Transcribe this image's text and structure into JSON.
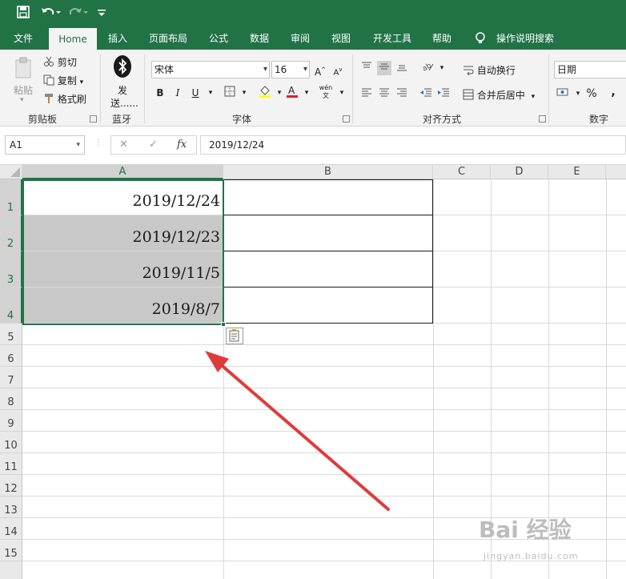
{
  "quick_access": {
    "save_icon": "save-icon",
    "undo_icon": "undo-icon",
    "redo_icon": "redo-icon",
    "customize_icon": "customize-icon"
  },
  "tabs": [
    {
      "label": "文件",
      "active": false
    },
    {
      "label": "Home",
      "active": true
    },
    {
      "label": "插入",
      "active": false
    },
    {
      "label": "页面布局",
      "active": false
    },
    {
      "label": "公式",
      "active": false
    },
    {
      "label": "数据",
      "active": false
    },
    {
      "label": "审阅",
      "active": false
    },
    {
      "label": "视图",
      "active": false
    },
    {
      "label": "开发工具",
      "active": false
    },
    {
      "label": "帮助",
      "active": false
    }
  ],
  "tell_me": "操作说明搜索",
  "ribbon": {
    "clipboard": {
      "paste": "粘贴",
      "cut": "剪切",
      "copy": "复制",
      "format_painter": "格式刷",
      "group": "剪贴板"
    },
    "bluetooth": {
      "send": "发",
      "send2": "送......",
      "group": "蓝牙"
    },
    "font": {
      "name": "宋体",
      "size": "16",
      "bold": "B",
      "italic": "I",
      "underline": "U",
      "group": "字体",
      "grow": "A",
      "shrink": "A",
      "phonetic": "wén"
    },
    "alignment": {
      "wrap": "自动换行",
      "merge": "合并后居中",
      "group": "对齐方式"
    },
    "number": {
      "format": "日期",
      "percent": "%",
      "comma": ",",
      "group": "数字"
    }
  },
  "formula_bar": {
    "name_box": "A1",
    "cancel": "✕",
    "enter": "✓",
    "fx": "fx",
    "content": "2019/12/24"
  },
  "sheet": {
    "columns": [
      "A",
      "B",
      "C",
      "D",
      "E"
    ],
    "rows": [
      "1",
      "2",
      "3",
      "4",
      "5",
      "6",
      "7",
      "8",
      "9",
      "10",
      "11",
      "12",
      "13",
      "14",
      "15"
    ],
    "cells": [
      "2019/12/24",
      "2019/12/23",
      "2019/11/5",
      "2019/8/7"
    ]
  },
  "colors": {
    "brand": "#217346",
    "selection_fill": "#c8c8c8",
    "arrow": "#e03b3b"
  },
  "watermark": {
    "main": "Bai 经验",
    "sub": "jingyan.baidu.com"
  }
}
